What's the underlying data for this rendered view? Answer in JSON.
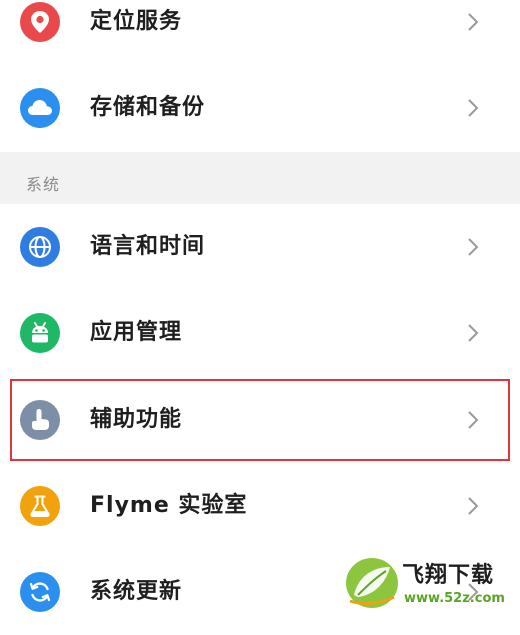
{
  "section_title": "系统",
  "items": [
    {
      "label": "定位服务",
      "icon": "location-pin-icon",
      "color": "#e9494b"
    },
    {
      "label": "存储和备份",
      "icon": "cloud-icon",
      "color": "#2b8ff0"
    },
    {
      "label": "语言和时间",
      "icon": "globe-icon",
      "color": "#2f7de1"
    },
    {
      "label": "应用管理",
      "icon": "android-robot-icon",
      "color": "#1fb866"
    },
    {
      "label": "辅助功能",
      "icon": "hand-pointer-icon",
      "color": "#7d8fa6"
    },
    {
      "label": "Flyme 实验室",
      "icon": "flask-icon",
      "color": "#f2a20d"
    },
    {
      "label": "系统更新",
      "icon": "refresh-icon",
      "color": "#2b8ff0"
    }
  ],
  "highlight_color": "#e0353a",
  "watermark": {
    "title": "飞翔下载",
    "url": "www.52z.com"
  }
}
